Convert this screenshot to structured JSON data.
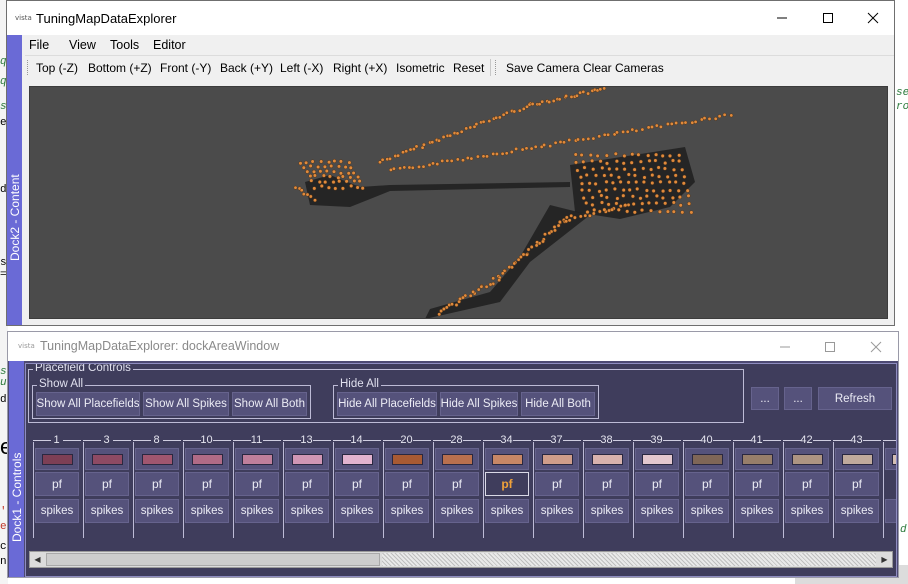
{
  "background_code": {
    "left_fragments": [
      "q",
      "q",
      "se",
      "er",
      "de",
      "s",
      "=",
      "st",
      "u",
      "d",
      "'j",
      "es",
      "cla",
      "nt"
    ],
    "right_fragments": [
      "se",
      "ro",
      "d"
    ],
    "heading_fragment": "e"
  },
  "main_window": {
    "title": "TuningMapDataExplorer",
    "logo_text": "vista",
    "menu": [
      "File",
      "View",
      "Tools",
      "Editor"
    ],
    "toolbar": {
      "buttons": [
        "Top (-Z)",
        "Bottom (+Z)",
        "Front (-Y)",
        "Back (+Y)",
        "Left (-X)",
        "Right (+X)",
        "Isometric",
        "Reset"
      ],
      "camera_buttons": [
        "Save Camera",
        "Clear Cameras"
      ]
    },
    "dock_tab": "Dock2 - Content",
    "colors": {
      "viewport_bg": "#4b4b4b",
      "point_color": "#e08a3c",
      "dock_tab": "#6a6ad6"
    }
  },
  "dock_window": {
    "title": "TuningMapDataExplorer: dockAreaWindow",
    "logo_text": "vista",
    "dock_tab": "Dock1 - Controls",
    "placefield_group_title": "Placefield Controls",
    "show_all": {
      "title": "Show All",
      "buttons": [
        "Show All Placefields",
        "Show All Spikes",
        "Show All Both"
      ]
    },
    "hide_all": {
      "title": "Hide All",
      "buttons": [
        "Hide All Placefields",
        "Hide All Spikes",
        "Hide All Both"
      ]
    },
    "extra_buttons": [
      "...",
      "...",
      "Refresh"
    ],
    "cells": [
      {
        "id": "1",
        "color": "#7d3f55",
        "pf": "pf",
        "spikes": "spikes",
        "active": false
      },
      {
        "id": "3",
        "color": "#8e4a63",
        "pf": "pf",
        "spikes": "spikes",
        "active": false
      },
      {
        "id": "8",
        "color": "#a0566f",
        "pf": "pf",
        "spikes": "spikes",
        "active": false
      },
      {
        "id": "10",
        "color": "#b06b86",
        "pf": "pf",
        "spikes": "spikes",
        "active": false
      },
      {
        "id": "11",
        "color": "#bf7f9b",
        "pf": "pf",
        "spikes": "spikes",
        "active": false
      },
      {
        "id": "13",
        "color": "#d096b4",
        "pf": "pf",
        "spikes": "spikes",
        "active": false
      },
      {
        "id": "14",
        "color": "#e2b3cf",
        "pf": "pf",
        "spikes": "spikes",
        "active": false
      },
      {
        "id": "20",
        "color": "#a85a33",
        "pf": "pf",
        "spikes": "spikes",
        "active": false
      },
      {
        "id": "28",
        "color": "#b9704e",
        "pf": "pf",
        "spikes": "spikes",
        "active": false
      },
      {
        "id": "34",
        "color": "#c78766",
        "pf": "pf",
        "spikes": "spikes",
        "active": true
      },
      {
        "id": "37",
        "color": "#cf9d8a",
        "pf": "pf",
        "spikes": "spikes",
        "active": false
      },
      {
        "id": "38",
        "color": "#d8b2ad",
        "pf": "pf",
        "spikes": "spikes",
        "active": false
      },
      {
        "id": "39",
        "color": "#e3c7ce",
        "pf": "pf",
        "spikes": "spikes",
        "active": false
      },
      {
        "id": "40",
        "color": "#7f6657",
        "pf": "pf",
        "spikes": "spikes",
        "active": false
      },
      {
        "id": "41",
        "color": "#977e6a",
        "pf": "pf",
        "spikes": "spikes",
        "active": false
      },
      {
        "id": "42",
        "color": "#ad9482",
        "pf": "pf",
        "spikes": "spikes",
        "active": false
      },
      {
        "id": "43",
        "color": "#c0aa9c",
        "pf": "pf",
        "spikes": "spikes",
        "active": false
      },
      {
        "id": "",
        "color": "#d3beb3",
        "pf": "",
        "spikes": "sp",
        "active": false
      }
    ]
  }
}
